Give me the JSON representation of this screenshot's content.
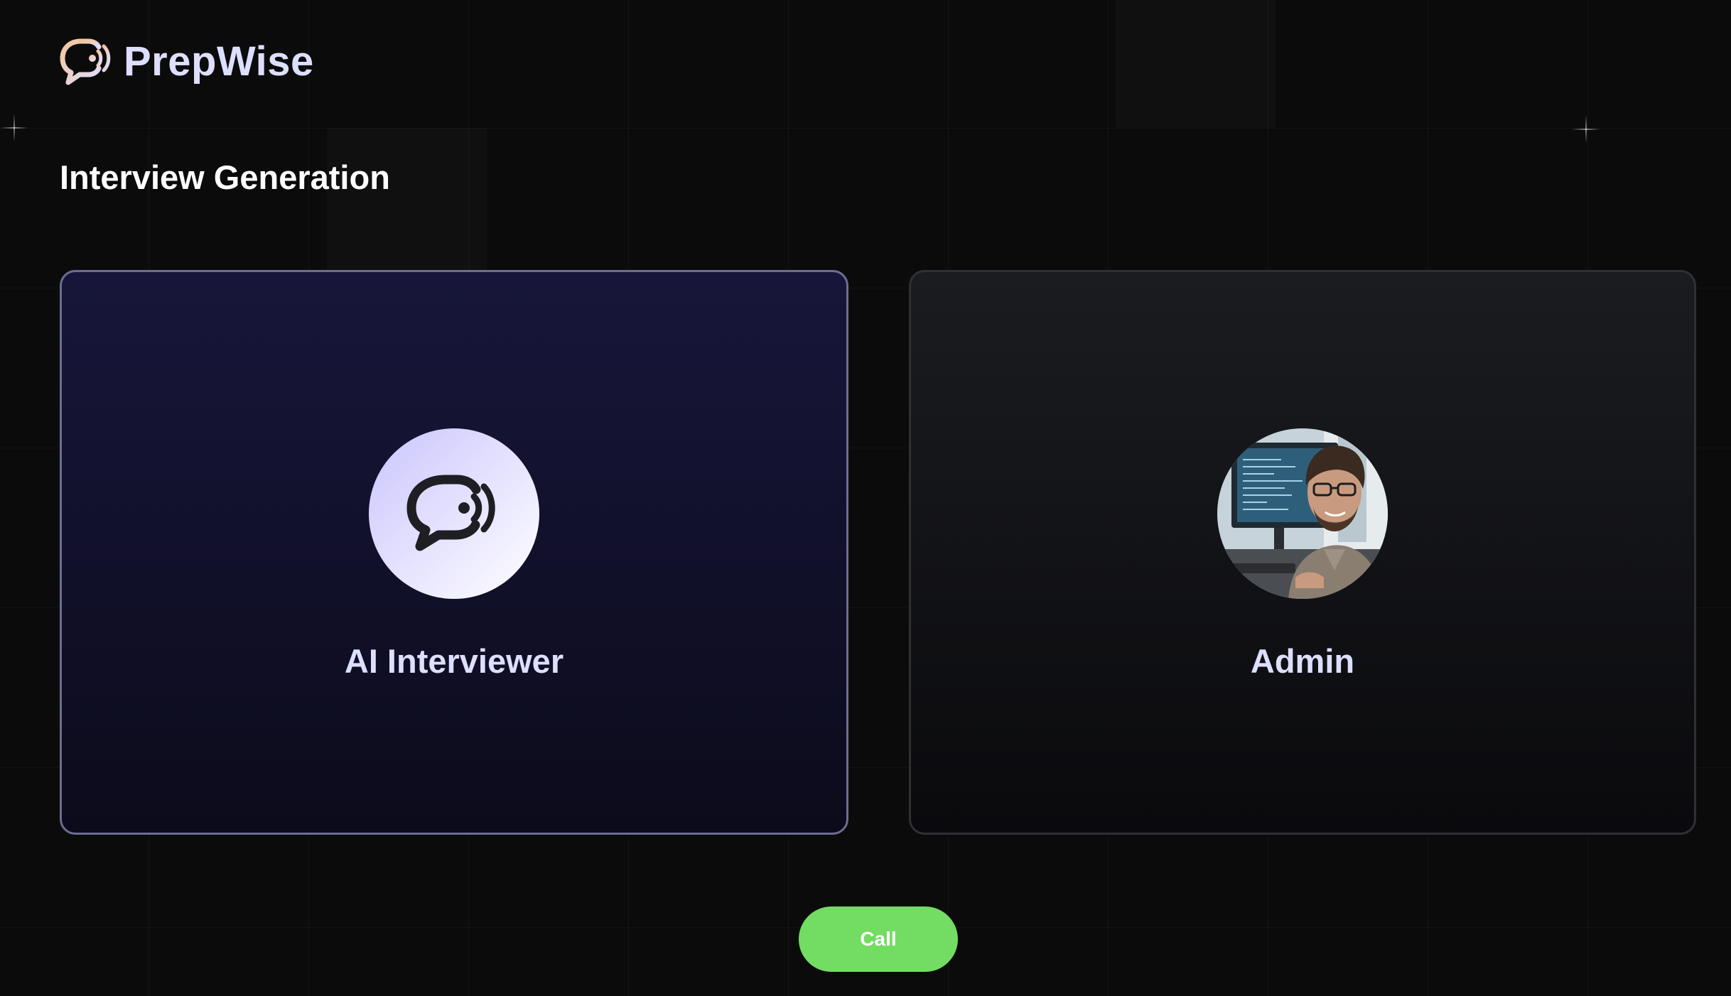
{
  "brand": {
    "name": "PrepWise",
    "logo_icon": "chat-bubble-sound-icon"
  },
  "page": {
    "title": "Interview Generation"
  },
  "cards": {
    "ai": {
      "label": "AI Interviewer",
      "icon": "chat-bubble-sound-icon"
    },
    "user": {
      "label": "Admin",
      "avatar": "user-photo"
    }
  },
  "actions": {
    "call_label": "Call"
  },
  "colors": {
    "background": "#0b0b0c",
    "brand_text": "#dddfff",
    "ai_card_border": "#6d6d93",
    "call_button": "#73dc62"
  }
}
